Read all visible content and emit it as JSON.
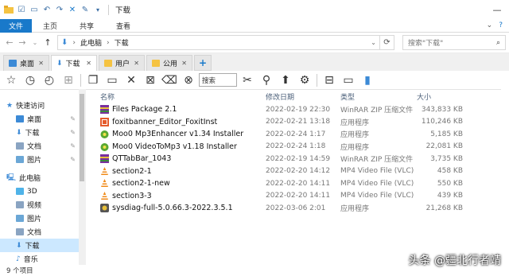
{
  "window": {
    "title": "下载"
  },
  "ribbon": {
    "tabs": [
      "文件",
      "主页",
      "共享",
      "查看"
    ]
  },
  "address": {
    "path": [
      "此电脑",
      "下载"
    ],
    "search_placeholder": "搜索\"下载\""
  },
  "folder_tabs": [
    {
      "label": "桌面",
      "color": "#3c8ad6"
    },
    {
      "label": "下载",
      "color": "#3c8ad6"
    },
    {
      "label": "用户",
      "color": "#f5c342"
    },
    {
      "label": "公用",
      "color": "#f5c342"
    }
  ],
  "toolbar": {
    "search_label": "搜索"
  },
  "nav": {
    "quick_access": "快速访问",
    "items": [
      {
        "label": "桌面",
        "pinned": true,
        "color": "#3c8ad6"
      },
      {
        "label": "下载",
        "pinned": true,
        "color": "#3c8ad6"
      },
      {
        "label": "文档",
        "pinned": true,
        "color": "#8aa4c2"
      },
      {
        "label": "图片",
        "pinned": true,
        "color": "#6ba7d6"
      }
    ],
    "this_pc": "此电脑",
    "pc_items": [
      {
        "label": "3D",
        "color": "#4fb3e8"
      },
      {
        "label": "视频",
        "color": "#8aa4c2"
      },
      {
        "label": "图片",
        "color": "#6ba7d6"
      },
      {
        "label": "文档",
        "color": "#8aa4c2"
      },
      {
        "label": "下载",
        "color": "#3c8ad6"
      },
      {
        "label": "音乐",
        "color": "#3c8ad6"
      }
    ]
  },
  "columns": {
    "name": "名称",
    "date": "修改日期",
    "type": "类型",
    "size": "大小"
  },
  "files": [
    {
      "name": "Files Package 2.1",
      "date": "2022-02-19 22:30",
      "type": "WinRAR ZIP 压缩文件",
      "size": "343,833 KB",
      "icon": "zip-icon"
    },
    {
      "name": "foxitbanner_Editor_FoxitInst",
      "date": "2022-02-21 13:18",
      "type": "应用程序",
      "size": "110,246 KB",
      "icon": "app-icon"
    },
    {
      "name": "Moo0 Mp3Enhancer v1.34 Installer",
      "date": "2022-02-24 1:17",
      "type": "应用程序",
      "size": "5,185 KB",
      "icon": "installer-icon"
    },
    {
      "name": "Moo0 VideoToMp3 v1.18 Installer",
      "date": "2022-02-24 1:18",
      "type": "应用程序",
      "size": "22,081 KB",
      "icon": "installer-icon"
    },
    {
      "name": "QTTabBar_1043",
      "date": "2022-02-19 14:59",
      "type": "WinRAR ZIP 压缩文件",
      "size": "3,735 KB",
      "icon": "zip-icon"
    },
    {
      "name": "section2-1",
      "date": "2022-02-20 14:12",
      "type": "MP4 Video File (VLC)",
      "size": "458 KB",
      "icon": "vlc-icon"
    },
    {
      "name": "section2-1-new",
      "date": "2022-02-20 14:11",
      "type": "MP4 Video File (VLC)",
      "size": "550 KB",
      "icon": "vlc-icon"
    },
    {
      "name": "section3-3",
      "date": "2022-02-20 14:11",
      "type": "MP4 Video File (VLC)",
      "size": "439 KB",
      "icon": "vlc-icon"
    },
    {
      "name": "sysdiag-full-5.0.66.3-2022.3.5.1",
      "date": "2022-03-06 2:01",
      "type": "应用程序",
      "size": "21,268 KB",
      "icon": "setup-icon"
    }
  ],
  "status": {
    "count": "9 个项目"
  },
  "watermark": "头条 @疆北行者靖"
}
